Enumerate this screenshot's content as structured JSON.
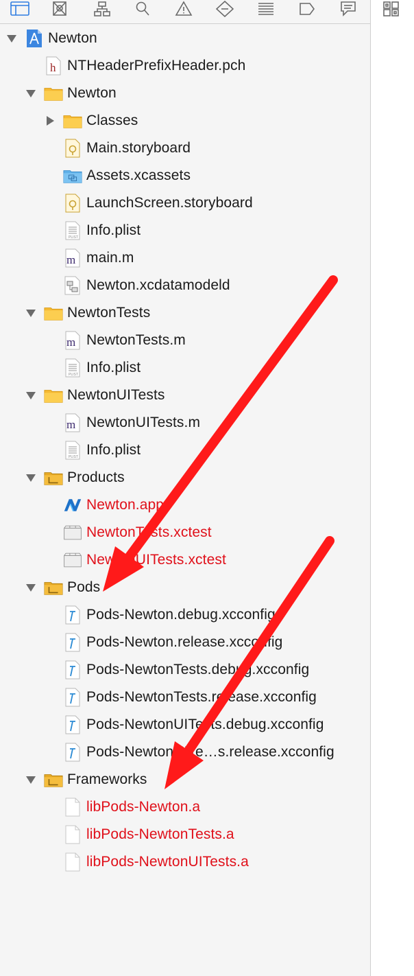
{
  "toolbar": {
    "icons": [
      "project-navigator-icon",
      "symbol-navigator-icon",
      "hierarchy-navigator-icon",
      "find-navigator-icon",
      "issue-navigator-icon",
      "test-navigator-icon",
      "debug-navigator-icon",
      "breakpoint-navigator-icon",
      "report-navigator-icon"
    ],
    "right_icon": "library-grid-icon"
  },
  "tree": [
    {
      "label": "Newton",
      "icon": "xcode-project",
      "disclosure": "open",
      "level": 0,
      "color": "normal"
    },
    {
      "label": "NTHeaderPrefixHeader.pch",
      "icon": "header-h",
      "disclosure": "none",
      "level": 1,
      "color": "normal"
    },
    {
      "label": "Newton",
      "icon": "folder-yellow",
      "disclosure": "open",
      "level": 1,
      "color": "normal"
    },
    {
      "label": "Classes",
      "icon": "folder-yellow",
      "disclosure": "closed",
      "level": 2,
      "color": "normal"
    },
    {
      "label": "Main.storyboard",
      "icon": "storyboard",
      "disclosure": "none",
      "level": 2,
      "color": "normal"
    },
    {
      "label": "Assets.xcassets",
      "icon": "folder-blue",
      "disclosure": "none",
      "level": 2,
      "color": "normal"
    },
    {
      "label": "LaunchScreen.storyboard",
      "icon": "storyboard",
      "disclosure": "none",
      "level": 2,
      "color": "normal"
    },
    {
      "label": "Info.plist",
      "icon": "plist",
      "disclosure": "none",
      "level": 2,
      "color": "normal"
    },
    {
      "label": "main.m",
      "icon": "source-m",
      "disclosure": "none",
      "level": 2,
      "color": "normal"
    },
    {
      "label": "Newton.xcdatamodeld",
      "icon": "datamodel",
      "disclosure": "none",
      "level": 2,
      "color": "normal"
    },
    {
      "label": "NewtonTests",
      "icon": "folder-yellow",
      "disclosure": "open",
      "level": 1,
      "color": "normal"
    },
    {
      "label": "NewtonTests.m",
      "icon": "source-m",
      "disclosure": "none",
      "level": 2,
      "color": "normal"
    },
    {
      "label": "Info.plist",
      "icon": "plist",
      "disclosure": "none",
      "level": 2,
      "color": "normal"
    },
    {
      "label": "NewtonUITests",
      "icon": "folder-yellow",
      "disclosure": "open",
      "level": 1,
      "color": "normal"
    },
    {
      "label": "NewtonUITests.m",
      "icon": "source-m",
      "disclosure": "none",
      "level": 2,
      "color": "normal"
    },
    {
      "label": "Info.plist",
      "icon": "plist",
      "disclosure": "none",
      "level": 2,
      "color": "normal"
    },
    {
      "label": "Products",
      "icon": "folder-yellow-dark",
      "disclosure": "open",
      "level": 1,
      "color": "normal"
    },
    {
      "label": "Newton.app",
      "icon": "app-logo",
      "disclosure": "none",
      "level": 2,
      "color": "red"
    },
    {
      "label": "NewtonTests.xctest",
      "icon": "bundle",
      "disclosure": "none",
      "level": 2,
      "color": "red"
    },
    {
      "label": "NewtonUITests.xctest",
      "icon": "bundle",
      "disclosure": "none",
      "level": 2,
      "color": "red"
    },
    {
      "label": "Pods",
      "icon": "folder-yellow-dark",
      "disclosure": "open",
      "level": 1,
      "color": "normal"
    },
    {
      "label": "Pods-Newton.debug.xcconfig",
      "icon": "xcconfig",
      "disclosure": "none",
      "level": 2,
      "color": "normal"
    },
    {
      "label": "Pods-Newton.release.xcconfig",
      "icon": "xcconfig",
      "disclosure": "none",
      "level": 2,
      "color": "normal"
    },
    {
      "label": "Pods-NewtonTests.debug.xcconfig",
      "icon": "xcconfig",
      "disclosure": "none",
      "level": 2,
      "color": "normal"
    },
    {
      "label": "Pods-NewtonTests.release.xcconfig",
      "icon": "xcconfig",
      "disclosure": "none",
      "level": 2,
      "color": "normal"
    },
    {
      "label": "Pods-NewtonUITests.debug.xcconfig",
      "icon": "xcconfig",
      "disclosure": "none",
      "level": 2,
      "color": "normal"
    },
    {
      "label": "Pods-NewtonUITe…s.release.xcconfig",
      "icon": "xcconfig",
      "disclosure": "none",
      "level": 2,
      "color": "normal"
    },
    {
      "label": "Frameworks",
      "icon": "folder-yellow-dark",
      "disclosure": "open",
      "level": 1,
      "color": "normal"
    },
    {
      "label": "libPods-Newton.a",
      "icon": "blank-file",
      "disclosure": "none",
      "level": 2,
      "color": "red"
    },
    {
      "label": "libPods-NewtonTests.a",
      "icon": "blank-file",
      "disclosure": "none",
      "level": 2,
      "color": "red"
    },
    {
      "label": "libPods-NewtonUITests.a",
      "icon": "blank-file",
      "disclosure": "none",
      "level": 2,
      "color": "red"
    }
  ],
  "colors": {
    "missing_file": "#e0101a",
    "annotation_arrow": "#ff1a1a",
    "selected_tab": "#2f7de1"
  }
}
